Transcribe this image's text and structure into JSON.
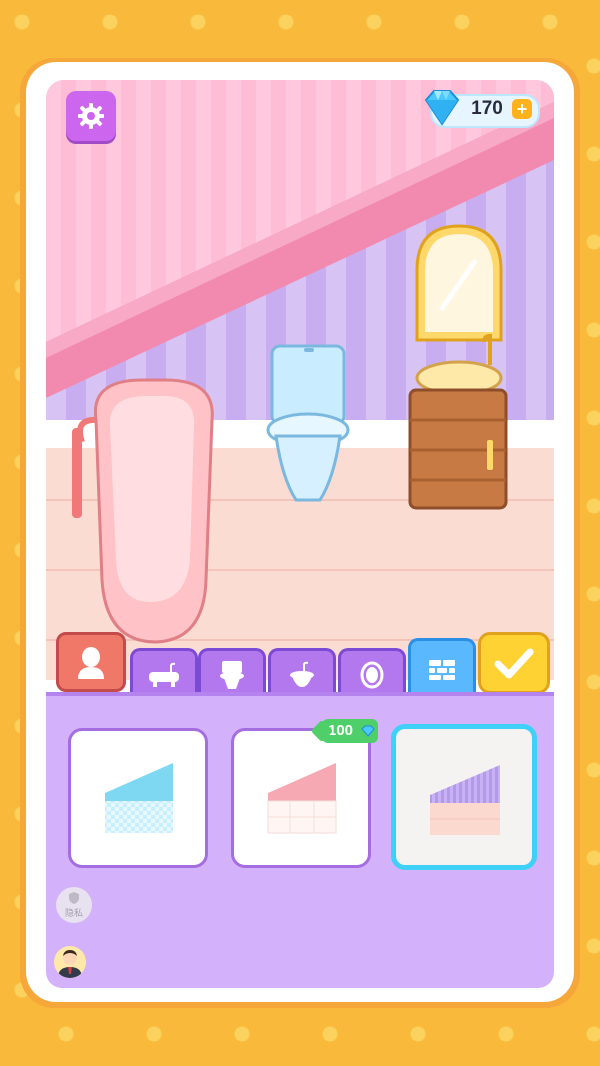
{
  "hud": {
    "settings_icon": "gear-icon",
    "gems": "170",
    "gem_icon": "diamond-icon",
    "add_icon": "plus-icon",
    "add_label": "+"
  },
  "scene": {
    "objects": [
      "bathtub",
      "toilet",
      "sink-cabinet",
      "mirror"
    ]
  },
  "tabs": {
    "avatar_icon": "avatar-icon",
    "items": [
      {
        "name": "bathtub",
        "icon": "bathtub-icon"
      },
      {
        "name": "toilet",
        "icon": "toilet-icon"
      },
      {
        "name": "sink",
        "icon": "sink-icon"
      },
      {
        "name": "mirror",
        "icon": "mirror-icon"
      },
      {
        "name": "wall",
        "icon": "wall-icon",
        "active": true
      }
    ],
    "confirm_icon": "checkmark-icon"
  },
  "items": [
    {
      "id": "blue-check-wall",
      "price": null,
      "selected": false
    },
    {
      "id": "pink-wall",
      "price": "100",
      "selected": false
    },
    {
      "id": "purple-stripe-wall",
      "price": null,
      "selected": true
    }
  ],
  "footer": {
    "privacy_label": "隐私",
    "privacy_icon": "shield-icon",
    "avatar_icon": "user-avatar-icon"
  },
  "colors": {
    "background": "#f9b93a",
    "panel": "#d4b2fb",
    "tab": "#b478ee",
    "tab_active": "#5ab8ff",
    "confirm": "#ffd233",
    "selected_border": "#3fd0f7",
    "price_tag": "#4fcf6a"
  }
}
